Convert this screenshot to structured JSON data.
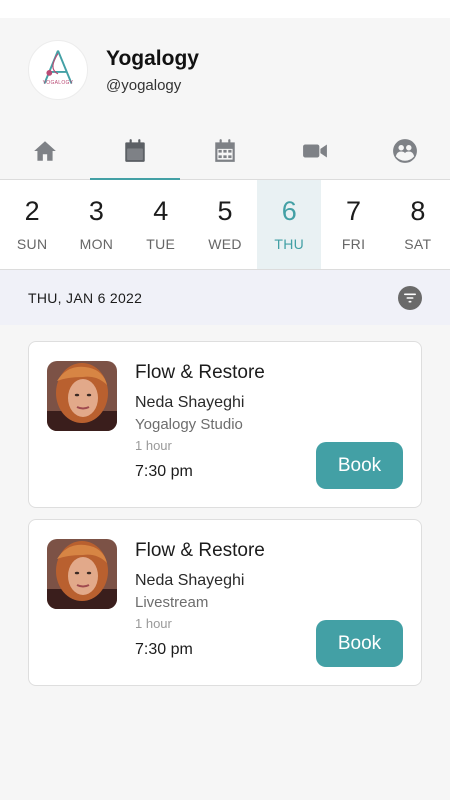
{
  "profile": {
    "logo_text": "YOGALOGY",
    "name": "Yogalogy",
    "handle": "@yogalogy"
  },
  "nav": {
    "tabs": [
      {
        "icon": "home-icon"
      },
      {
        "icon": "calendar-icon",
        "active": true
      },
      {
        "icon": "calendar-grid-icon"
      },
      {
        "icon": "video-icon"
      },
      {
        "icon": "people-icon"
      }
    ]
  },
  "days": [
    {
      "num": "2",
      "name": "SUN"
    },
    {
      "num": "3",
      "name": "MON"
    },
    {
      "num": "4",
      "name": "TUE"
    },
    {
      "num": "5",
      "name": "WED"
    },
    {
      "num": "6",
      "name": "THU",
      "active": true
    },
    {
      "num": "7",
      "name": "FRI"
    },
    {
      "num": "8",
      "name": "SAT"
    }
  ],
  "date_label": "THU, JAN 6 2022",
  "classes": [
    {
      "name": "Flow & Restore",
      "instructor": "Neda Shayeghi",
      "location": "Yogalogy Studio",
      "duration": "1 hour",
      "time": "7:30 pm",
      "button": "Book"
    },
    {
      "name": "Flow & Restore",
      "instructor": "Neda Shayeghi",
      "location": "Livestream",
      "duration": "1 hour",
      "time": "7:30 pm",
      "button": "Book"
    }
  ],
  "colors": {
    "accent": "#43a0a5",
    "active_day_bg": "#e9f1f3",
    "date_bar_bg": "#f0f1f8"
  }
}
